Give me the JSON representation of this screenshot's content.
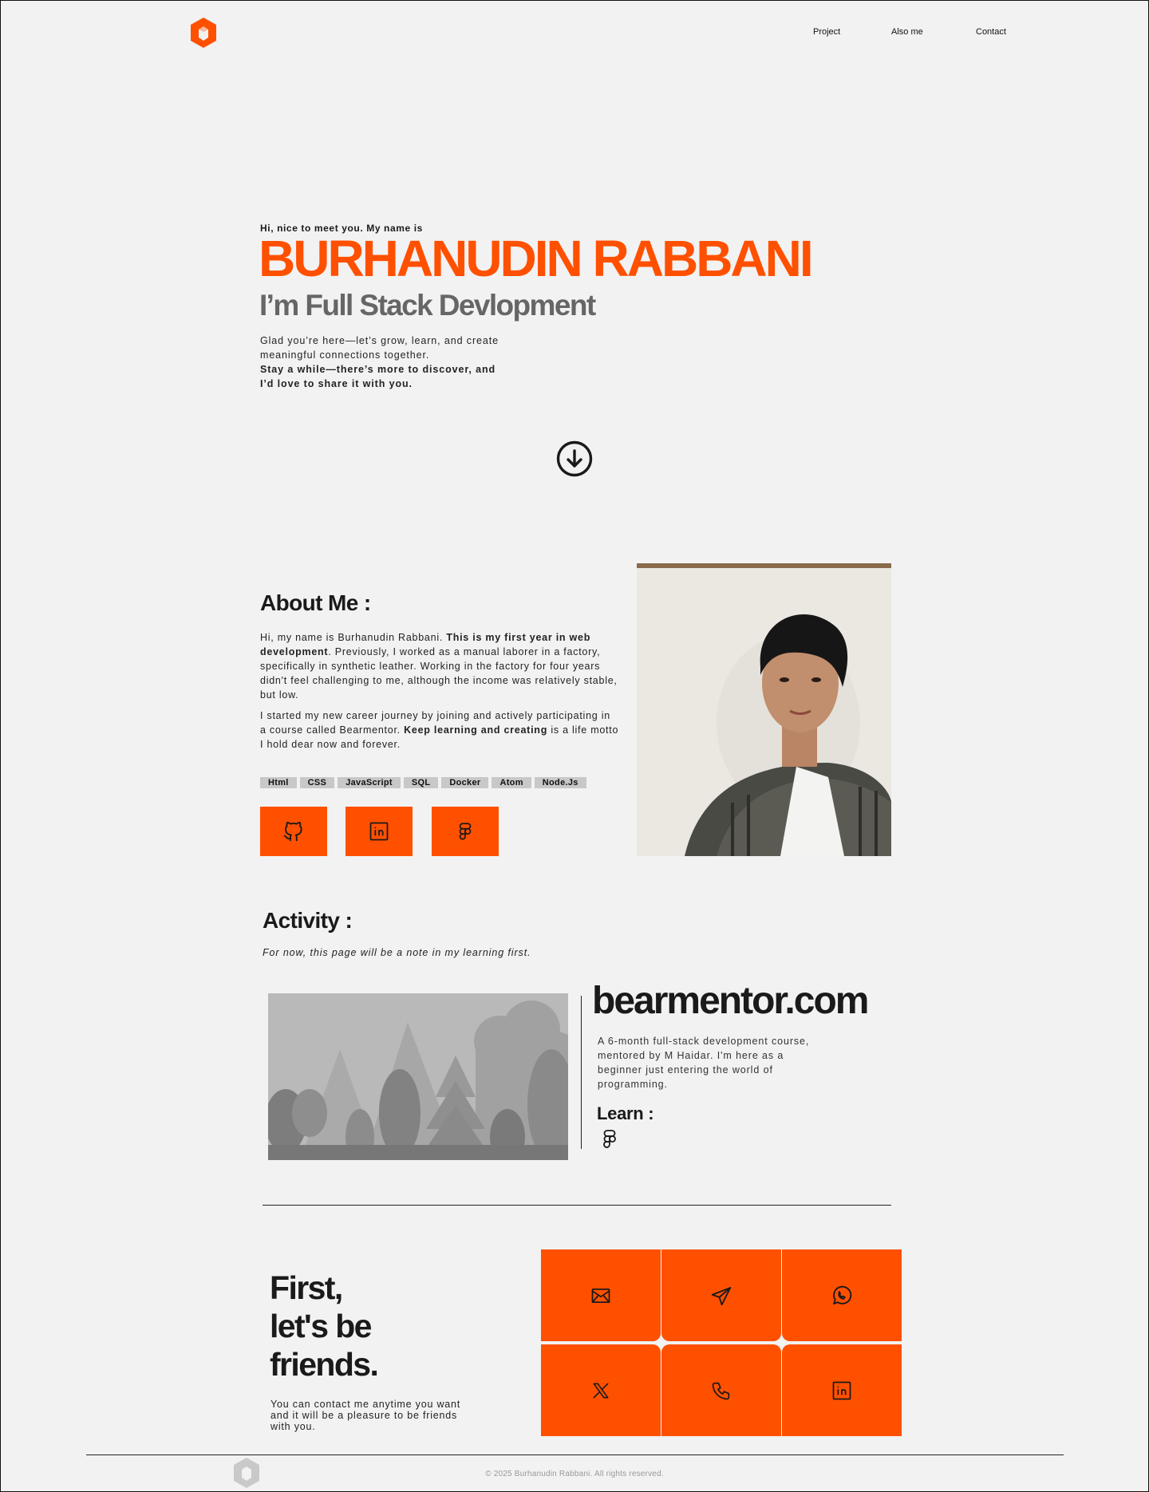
{
  "colors": {
    "accent": "#ff5000",
    "background": "#f2f2f2",
    "text": "#1a1a1a",
    "muted": "#666666",
    "tag": "#c8c8c8"
  },
  "nav": {
    "items": [
      {
        "label": "Project"
      },
      {
        "label": "Also me"
      },
      {
        "label": "Contact"
      }
    ]
  },
  "hero": {
    "greeting": "Hi, nice to meet you. My name is",
    "name": "BURHANUDIN RABBANI",
    "role": "I’m Full Stack Devlopment",
    "intro": "Glad you’re here—let’s grow, learn, and create meaningful connections together.",
    "intro_strong": "Stay a while—there’s more to discover, and I’d love to share it with you.",
    "scroll_icon": "arrow-down-circle-icon"
  },
  "about": {
    "title": "About Me :",
    "p1_start": "Hi, my name is Burhanudin Rabbani. ",
    "p1_bold": "This is my first year in web development",
    "p1_end": ". Previously, I worked as a manual laborer in a factory, specifically in synthetic leather. Working in the factory for four years didn't feel challenging to me, although the income was relatively stable, but low.",
    "p2_start": "I started my new career journey by joining and actively participating in a course called Bearmentor. ",
    "p2_bold": "Keep learning and creating",
    "p2_end": " is a life motto I hold dear now and forever.",
    "skills": [
      "Html",
      "CSS",
      "JavaScript",
      "SQL",
      "Docker",
      "Atom",
      "Node.Js"
    ],
    "socials": [
      {
        "icon": "github-icon"
      },
      {
        "icon": "linkedin-icon"
      },
      {
        "icon": "figma-icon"
      }
    ]
  },
  "activity": {
    "title": "Activity :",
    "note": "For now, this page will be a note in my learning first.",
    "site": "bearmentor.com",
    "description": "A 6-month full-stack development course, mentored by M Haidar. I'm here as a beginner just entering the world of programming.",
    "learn_title": "Learn :",
    "learn_icon": "figma-icon"
  },
  "contact": {
    "headline": [
      "First,",
      "let's be",
      "friends."
    ],
    "text": "You can contact me anytime you want and it will be a pleasure to be friends with you.",
    "buttons": [
      {
        "icon": "mail-icon"
      },
      {
        "icon": "telegram-icon"
      },
      {
        "icon": "whatsapp-icon"
      },
      {
        "icon": "x-icon"
      },
      {
        "icon": "phone-icon"
      },
      {
        "icon": "linkedin-icon"
      }
    ]
  },
  "footer": {
    "copyright": "© 2025 Burhanudin Rabbani. All rights reserved."
  }
}
